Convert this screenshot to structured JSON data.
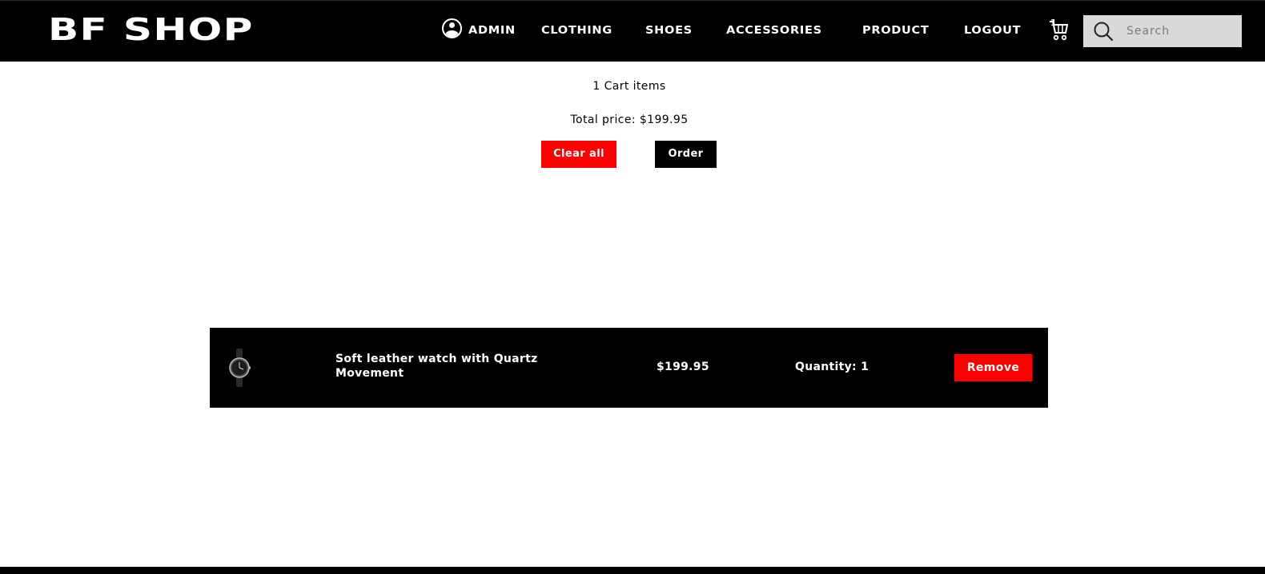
{
  "header": {
    "logo": "BF SHOP",
    "nav": {
      "admin": "ADMIN",
      "clothing": "CLOTHING",
      "shoes": "SHOES",
      "accessories": "ACCESSORIES",
      "product": "PRODUCT",
      "logout": "LOGOUT"
    },
    "cart_count": "1",
    "search": {
      "placeholder": "Search",
      "value": ""
    }
  },
  "summary": {
    "items_text": "1 Cart items",
    "total_text": "Total price: $199.95",
    "clear_label": "Clear all",
    "order_label": "Order"
  },
  "cart_items": [
    {
      "name": "Soft leather watch with Quartz Movement",
      "price": "$199.95",
      "quantity_text": "Quantity: 1",
      "remove_label": "Remove"
    }
  ],
  "colors": {
    "header_bg": "#000000",
    "accent_red": "#ff0000",
    "search_bg": "#d9d9d9",
    "row_bg": "#000000"
  },
  "icons": {
    "user": "user-circle-icon",
    "cart": "shopping-cart-icon",
    "search": "search-icon",
    "product": "watch-icon"
  }
}
